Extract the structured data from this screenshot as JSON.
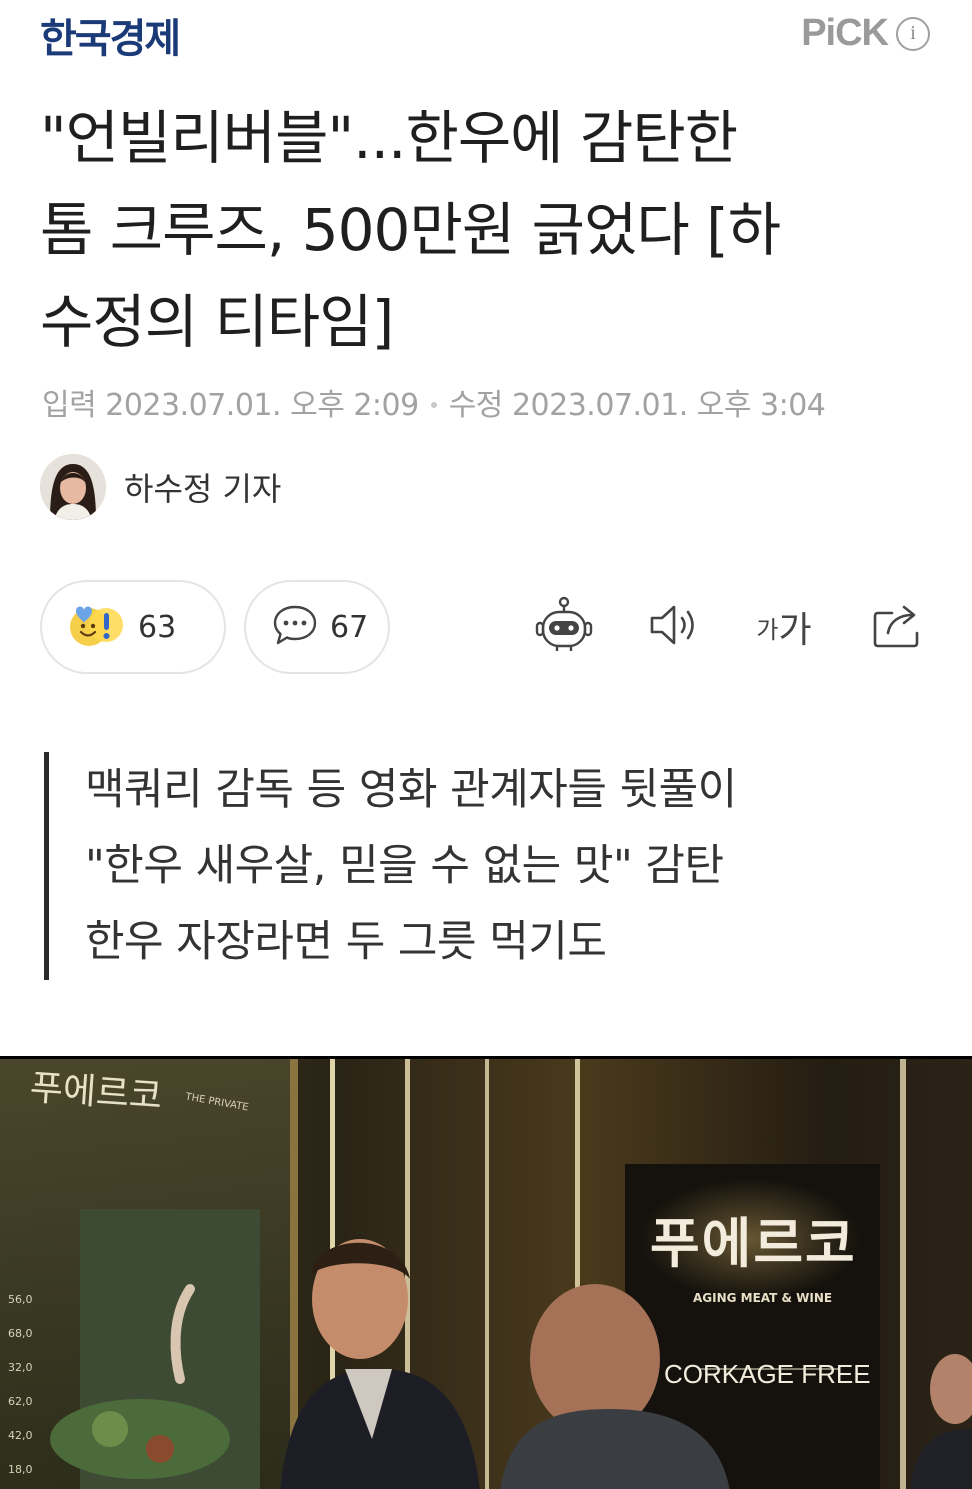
{
  "header": {
    "brand": "한국경제",
    "pick_label": "PiCK",
    "info_glyph": "i"
  },
  "article": {
    "title_lines": [
      "\"언빌리버블\"...한우에 감탄한",
      "톰 크루즈, 500만원 긁었다 [하",
      "수정의 티타임]"
    ],
    "published_label": "입력",
    "published": "2023.07.01. 오후 2:09",
    "modified_label": "수정",
    "modified": "2023.07.01. 오후 3:04",
    "author": "하수정 기자"
  },
  "reactions": {
    "like_count": "63",
    "comment_count": "67"
  },
  "toolbar": {
    "font_small": "가",
    "font_large": "가"
  },
  "summary": [
    "맥쿼리 감독 등 영화 관계자들 뒷풀이",
    "\"한우 새우살, 믿을 수 없는 맛\" 감탄",
    "한우 자장라면 두 그릇 먹기도"
  ],
  "photo": {
    "sign_main": "푸에르코",
    "sign_sub": "AGING MEAT & WINE",
    "sign_corkage": "CORKAGE FREE",
    "left_sign": "푸에르코",
    "left_small": "THE PRIVATE",
    "menu_values": [
      "56,0",
      "68,0",
      "32,0",
      "62,0",
      "42,0",
      "18,0"
    ]
  },
  "colors": {
    "brand": "#1b3a78",
    "muted": "#a2a2a2"
  },
  "icons": [
    "info-icon",
    "reaction-emoji-icon",
    "comment-icon",
    "ai-bot-icon",
    "speaker-icon",
    "share-icon"
  ]
}
